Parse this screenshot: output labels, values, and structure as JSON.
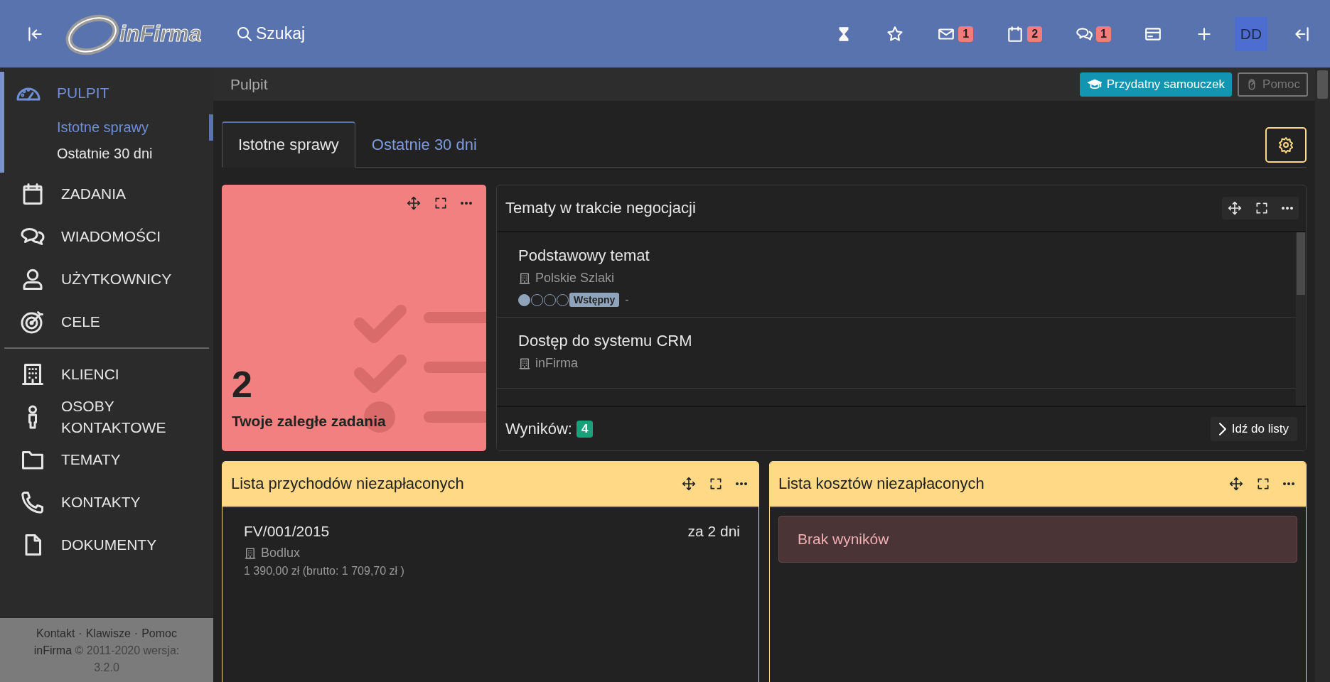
{
  "topbar": {
    "logo": "inFirma",
    "search": "Szukaj",
    "mail_badge": "1",
    "calendar_badge": "2",
    "chat_badge": "1",
    "avatar": "DD"
  },
  "sidebar": {
    "sections": [
      {
        "items": [
          {
            "label": "PULPIT",
            "selected": true,
            "children": [
              {
                "label": "Istotne sprawy",
                "selected": true
              },
              {
                "label": "Ostatnie 30 dni",
                "selected": false
              }
            ]
          },
          {
            "label": "ZADANIA",
            "selected": false
          },
          {
            "label": "WIADOMOŚCI",
            "selected": false
          },
          {
            "label": "UŻYTKOWNICY",
            "selected": false
          },
          {
            "label": "CELE",
            "selected": false
          }
        ]
      },
      {
        "items": [
          {
            "label": "KLIENCI",
            "selected": false
          },
          {
            "label": "OSOBY KONTAKTOWE",
            "selected": false
          },
          {
            "label": "TEMATY",
            "selected": false
          },
          {
            "label": "KONTAKTY",
            "selected": false
          },
          {
            "label": "DOKUMENTY",
            "selected": false
          }
        ]
      }
    ],
    "footer": {
      "links": [
        "Kontakt",
        "Klawisze",
        "Pomoc"
      ],
      "separator": "·",
      "brand": "inFirma",
      "copyright": "© 2011-2020 wersja: 3.2.0"
    }
  },
  "breadcrumb": "Pulpit",
  "header_buttons": [
    {
      "label": "Przydatny samouczek",
      "kind": "primary"
    },
    {
      "label": "Pomoc",
      "kind": "outline"
    }
  ],
  "tabs": [
    {
      "label": "Istotne sprawy",
      "selected": true
    },
    {
      "label": "Ostatnie 30 dni",
      "selected": false
    }
  ],
  "widgets": [
    {
      "kind": "counter",
      "count": "2",
      "label": "Twoje zaległe zadania"
    },
    {
      "kind": "topics",
      "title": "Tematy w trakcie negocjacji",
      "highlighted": false,
      "items": [
        {
          "title": "Podstawowy temat",
          "company": "Polskie Szlaki",
          "stars": 1,
          "stage": "Wstępny",
          "suffix": "-"
        },
        {
          "title": "Dostęp do systemu CRM",
          "company": "inFirma"
        }
      ],
      "results_label": "Wyników:",
      "results_count": "4",
      "link": "Idź do listy"
    },
    {
      "kind": "invoices",
      "title": "Lista przychodów niezapłaconych",
      "highlighted": true,
      "items": [
        {
          "number": "FV/001/2015",
          "due": "za 2 dni",
          "client": "Bodlux",
          "amount": "1 390,00 zł (brutto: 1 709,70 zł )"
        }
      ]
    },
    {
      "kind": "invoices",
      "title": "Lista kosztów niezapłaconych",
      "highlighted": true,
      "empty": "Brak wyników"
    }
  ]
}
